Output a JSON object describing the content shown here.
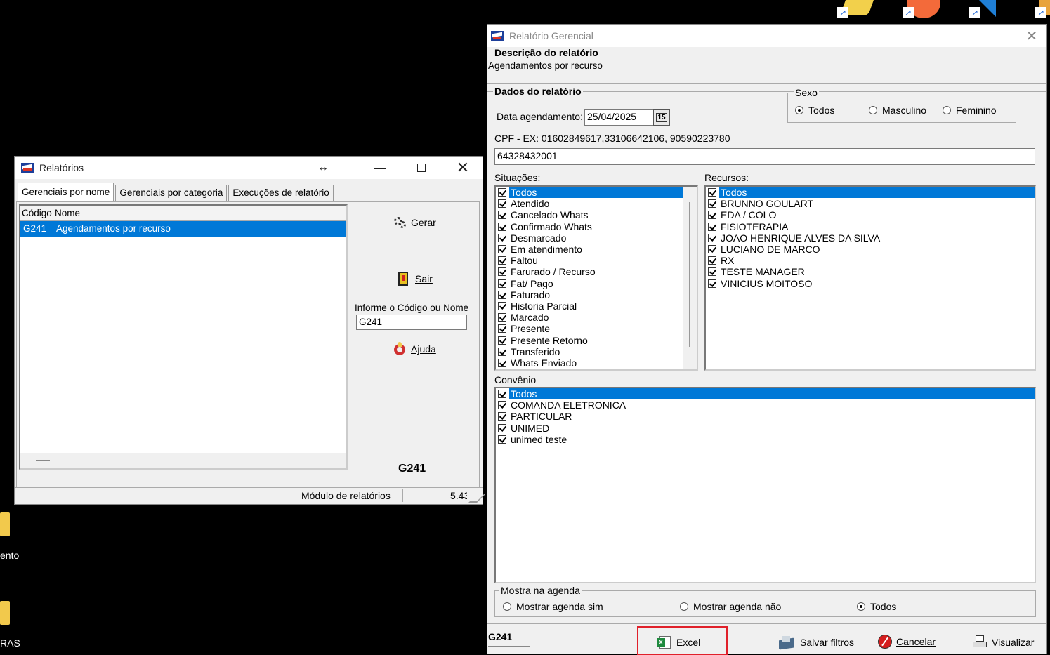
{
  "desktop": {
    "labels": [
      "ento",
      "RAS"
    ]
  },
  "relatorios": {
    "title": "Relatórios",
    "tabs": [
      "Gerenciais por nome",
      "Gerenciais por categoria",
      "Execuções de relatório"
    ],
    "columns": [
      "Código",
      "Nome"
    ],
    "rows": [
      {
        "code": "G241",
        "name": "Agendamentos por recurso"
      }
    ],
    "gerar_label": "Gerar",
    "sair_label": "Sair",
    "search_label": "Informe o Código ou Nome",
    "search_value": "G241",
    "ajuda_label": "Ajuda",
    "code_display": "G241",
    "status_module": "Módulo de relatórios",
    "status_version": "5.43"
  },
  "gerencial": {
    "title": "Relatório Gerencial",
    "descricao_title": "Descrição do relatório",
    "descricao_value": "Agendamentos por recurso",
    "dados_title": "Dados do relatório",
    "data_label": "Data agendamento:",
    "data_value": "25/04/2025",
    "calendar_label": "15",
    "sexo_title": "Sexo",
    "sexo_options": [
      "Todos",
      "Masculino",
      "Feminino"
    ],
    "sexo_selected": "Todos",
    "cpf_label": "CPF - EX: 01602849617,33106642106, 90590223780",
    "cpf_value": "64328432001",
    "situacoes_label": "Situações:",
    "situacoes": [
      "Todos",
      "Atendido",
      "Cancelado Whats",
      "Confirmado Whats",
      "Desmarcado",
      "Em atendimento",
      "Faltou",
      "Farurado / Recurso",
      "Fat/ Pago",
      "Faturado",
      "Historia Parcial",
      "Marcado",
      "Presente",
      "Presente Retorno",
      "Transferido",
      "Whats Enviado"
    ],
    "recursos_label": "Recursos:",
    "recursos": [
      "Todos",
      "BRUNNO GOULART",
      "EDA / COLO",
      "FISIOTERAPIA",
      "JOAO HENRIQUE ALVES DA SILVA",
      "LUCIANO DE MARCO",
      "RX",
      "TESTE  MANAGER",
      "VINICIUS MOITOSO"
    ],
    "convenio_label": "Convênio",
    "convenios": [
      "Todos",
      "COMANDA ELETRONICA",
      "PARTICULAR",
      "UNIMED",
      "unimed teste"
    ],
    "agenda_title": "Mostra na agenda",
    "agenda_options": [
      "Mostrar agenda sim",
      "Mostrar agenda não",
      "Todos"
    ],
    "agenda_selected": "Todos",
    "code_display": "G241",
    "excel_label": "Excel",
    "salvar_label": "Salvar filtros",
    "cancelar_label": "Cancelar",
    "visualizar_label": "Visualizar",
    "highlight_color": "#e0202a"
  }
}
